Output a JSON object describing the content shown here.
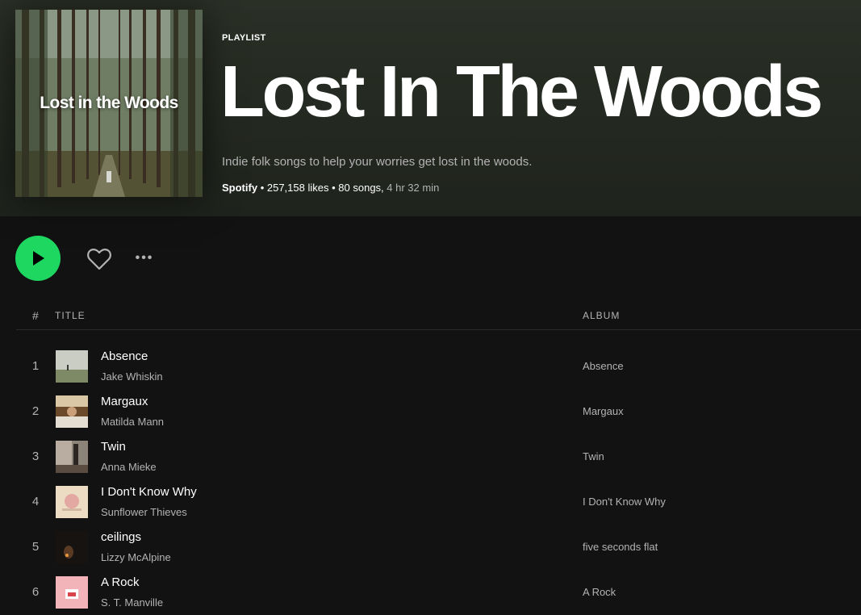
{
  "header": {
    "cover_text": "Lost in the Woods",
    "type_label": "PLAYLIST",
    "title": "Lost In The Woods",
    "description": "Indie folk songs to help your worries get lost in the woods.",
    "owner": "Spotify",
    "likes": "257,158 likes",
    "songs": "80 songs,",
    "duration": "4 hr 32 min"
  },
  "actions": {
    "play_icon": "play-icon",
    "like_icon": "heart-outline-icon",
    "more_label": "•••"
  },
  "table": {
    "headers": {
      "num": "#",
      "title": "TITLE",
      "album": "ALBUM"
    },
    "tracks": [
      {
        "num": "1",
        "title": "Absence",
        "artist": "Jake Whiskin",
        "album": "Absence"
      },
      {
        "num": "2",
        "title": "Margaux",
        "artist": "Matilda Mann",
        "album": "Margaux"
      },
      {
        "num": "3",
        "title": "Twin",
        "artist": "Anna Mieke",
        "album": "Twin"
      },
      {
        "num": "4",
        "title": "I Don't Know Why",
        "artist": "Sunflower Thieves",
        "album": "I Don't Know Why"
      },
      {
        "num": "5",
        "title": "ceilings",
        "artist": "Lizzy McAlpine",
        "album": "five seconds flat"
      },
      {
        "num": "6",
        "title": "A Rock",
        "artist": "S. T. Manville",
        "album": "A Rock"
      }
    ]
  },
  "colors": {
    "accent": "#1ed760",
    "background": "#121212",
    "header_bg": "#2a3026",
    "text_secondary": "#b3b3b3"
  }
}
